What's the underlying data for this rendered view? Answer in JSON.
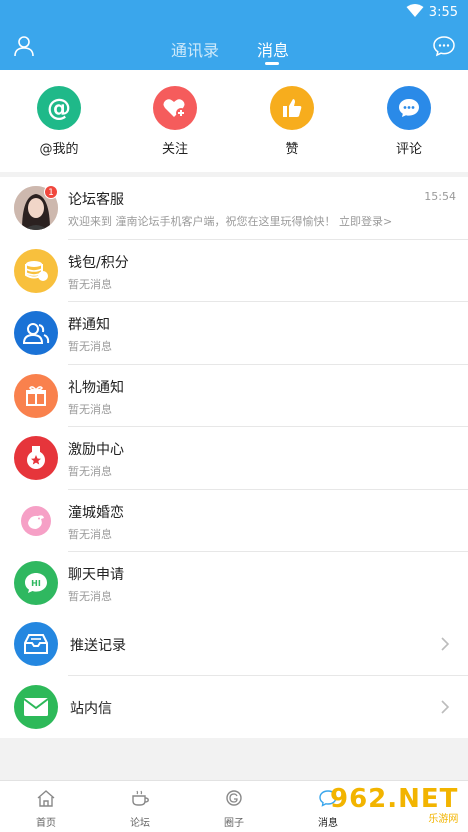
{
  "status_bar": {
    "time": "3:55"
  },
  "header": {
    "tabs": [
      {
        "label": "通讯录"
      },
      {
        "label": "消息"
      }
    ],
    "active_tab": "消息"
  },
  "quick_actions": [
    {
      "label": "@我的",
      "color": "#1fb989",
      "icon": "at-icon"
    },
    {
      "label": "关注",
      "color": "#f55c5c",
      "icon": "heart-plus-icon"
    },
    {
      "label": "赞",
      "color": "#f7ad1d",
      "icon": "thumbs-up-icon"
    },
    {
      "label": "评论",
      "color": "#2a8ae8",
      "icon": "comment-bubble-icon"
    }
  ],
  "messages": [
    {
      "title": "论坛客服",
      "subtitle": "欢迎来到 潼南论坛手机客户端，祝您在这里玩得愉快！ 立即登录>",
      "time": "15:54",
      "badge": "1",
      "icon": "user-avatar"
    },
    {
      "title": "钱包/积分",
      "subtitle": "暂无消息",
      "color": "#f8c03d",
      "icon": "coins-icon"
    },
    {
      "title": "群通知",
      "subtitle": "暂无消息",
      "color": "#1a72d6",
      "icon": "group-icon"
    },
    {
      "title": "礼物通知",
      "subtitle": "暂无消息",
      "color": "#f9814d",
      "icon": "gift-icon"
    },
    {
      "title": "激励中心",
      "subtitle": "暂无消息",
      "color": "#e6353b",
      "icon": "medal-icon"
    },
    {
      "title": "潼城婚恋",
      "subtitle": "暂无消息",
      "color": "#f6a0c6",
      "icon": "bird-icon"
    },
    {
      "title": "聊天申请",
      "subtitle": "暂无消息",
      "color": "#2fb860",
      "icon": "hi-chat-icon"
    }
  ],
  "links": [
    {
      "title": "推送记录",
      "color": "#2487e0",
      "icon": "inbox-icon"
    },
    {
      "title": "站内信",
      "color": "#2db959",
      "icon": "envelope-icon"
    }
  ],
  "bottom_nav": [
    {
      "label": "首页",
      "icon": "home-icon"
    },
    {
      "label": "论坛",
      "icon": "coffee-cup-icon"
    },
    {
      "label": "圈子",
      "icon": "circle-icon"
    },
    {
      "label": "消息",
      "icon": "message-icon"
    }
  ],
  "watermark": {
    "text": "962.NET",
    "sub": "乐游网"
  }
}
